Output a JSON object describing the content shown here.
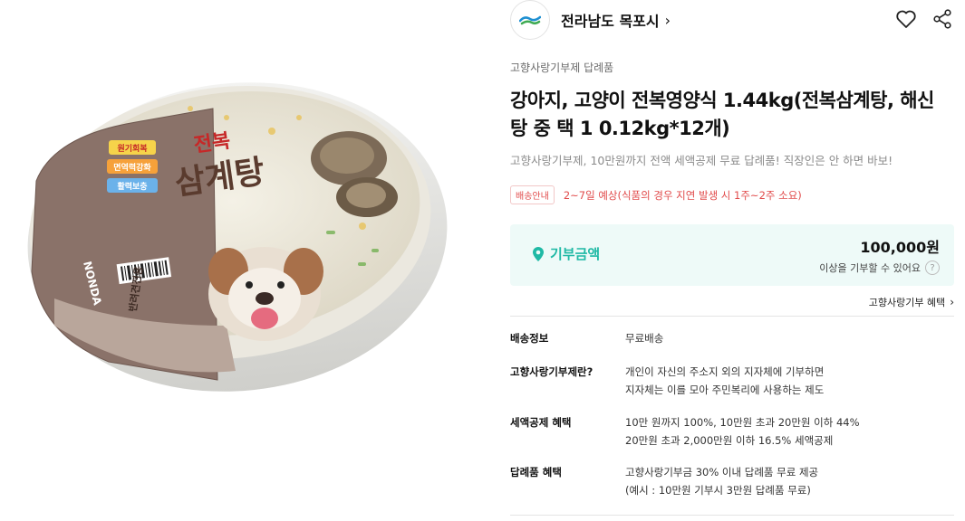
{
  "seller": {
    "name": "전라남도 목포시",
    "chevron": "›"
  },
  "icons": {
    "favorite": "heart-icon",
    "share": "share-icon",
    "help": "?",
    "pin": "location-pin-icon"
  },
  "product": {
    "category": "고향사랑기부제 답례품",
    "title": "강아지, 고양이 전복영양식 1.44kg(전복삼계탕, 해신탕 중 택 1 0.12kg*12개)",
    "subtitle": "고향사랑기부제, 10만원까지 전액 세액공제 무료 답례품! 직장인은 안 하면 바보!",
    "image_text": {
      "brand": "전복",
      "name": "삼계탕",
      "tags": [
        "원기회복",
        "면역력강화",
        "활력보충"
      ],
      "maker": "NONDA",
      "footer": "반려견전용"
    }
  },
  "delivery": {
    "badge": "배송안내",
    "text": "2~7일 예상(식품의 경우 지연 발생 시 1주~2주 소요)"
  },
  "donation": {
    "label": "기부금액",
    "amount": "100,000원",
    "note": "이상을 기부할 수 있어요"
  },
  "benefit_link": "고향사랑기부 혜택",
  "colors": {
    "accent": "#1fb9a5",
    "box_bg": "#eefaf8",
    "alert": "#e14b4b"
  },
  "info": [
    {
      "label": "배송정보",
      "lines": [
        "무료배송"
      ]
    },
    {
      "label": "고향사랑기부제란?",
      "lines": [
        "개인이 자신의 주소지 외의 지자체에 기부하면",
        "지자체는 이를 모아 주민복리에 사용하는 제도"
      ]
    },
    {
      "label": "세액공제 혜택",
      "lines": [
        "10만 원까지 100%, 10만원 초과 20만원 이하 44%",
        "20만원 초과 2,000만원 이하 16.5% 세액공제"
      ]
    },
    {
      "label": "답례품 혜택",
      "lines": [
        "고향사랑기부금 30% 이내 답례품 무료 제공",
        "(예시 : 10만원 기부시 3만원 답례품 무료)"
      ]
    }
  ]
}
